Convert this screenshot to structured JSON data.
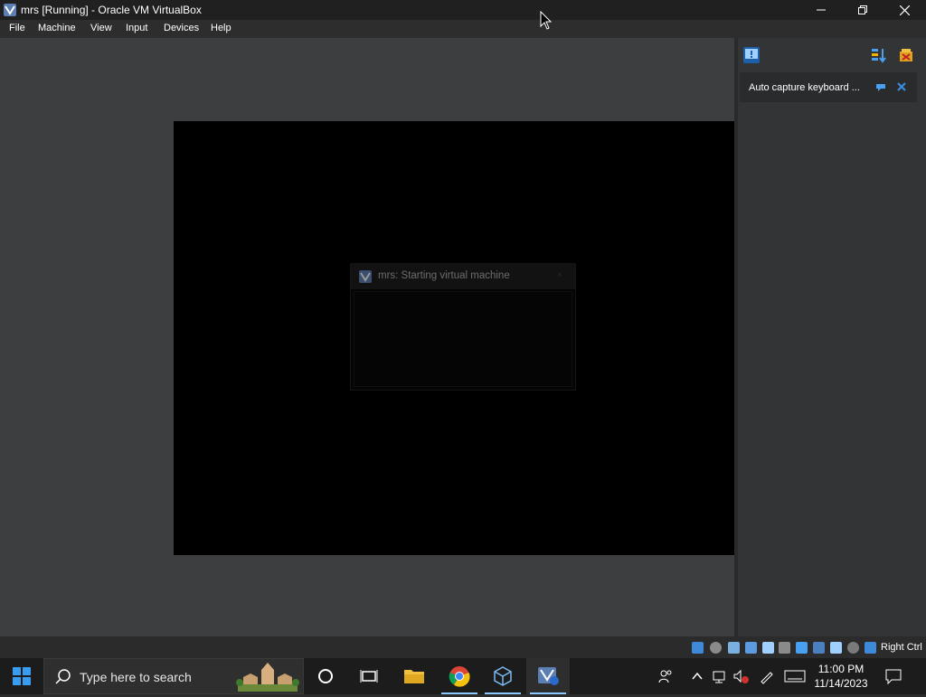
{
  "window": {
    "title": "mrs [Running] - Oracle VM VirtualBox",
    "icon": "virtualbox-icon"
  },
  "menubar": {
    "items": [
      {
        "label": "File"
      },
      {
        "label": "Machine"
      },
      {
        "label": "View"
      },
      {
        "label": "Input"
      },
      {
        "label": "Devices"
      },
      {
        "label": "Help"
      }
    ]
  },
  "vm_dialog": {
    "title": "mrs: Starting virtual machine",
    "close_glyph": "×"
  },
  "notification_center": {
    "notification": {
      "text": "Auto capture keyboard ..."
    }
  },
  "statusbar": {
    "host_key": "Right Ctrl",
    "icons": [
      "hard-disk-icon",
      "optical-drive-icon",
      "audio-icon",
      "network-icon",
      "usb-icon",
      "shared-folders-icon",
      "display-icon",
      "recording-icon",
      "cpu-icon",
      "mouse-integration-icon",
      "keyboard-capture-icon"
    ]
  },
  "taskbar": {
    "search_placeholder": "Type here to search",
    "clock_time": "11:00 PM",
    "clock_date": "11/14/2023",
    "colors": {
      "accent_underline": "#8cc8ff",
      "background": "#1c1c1c"
    }
  }
}
